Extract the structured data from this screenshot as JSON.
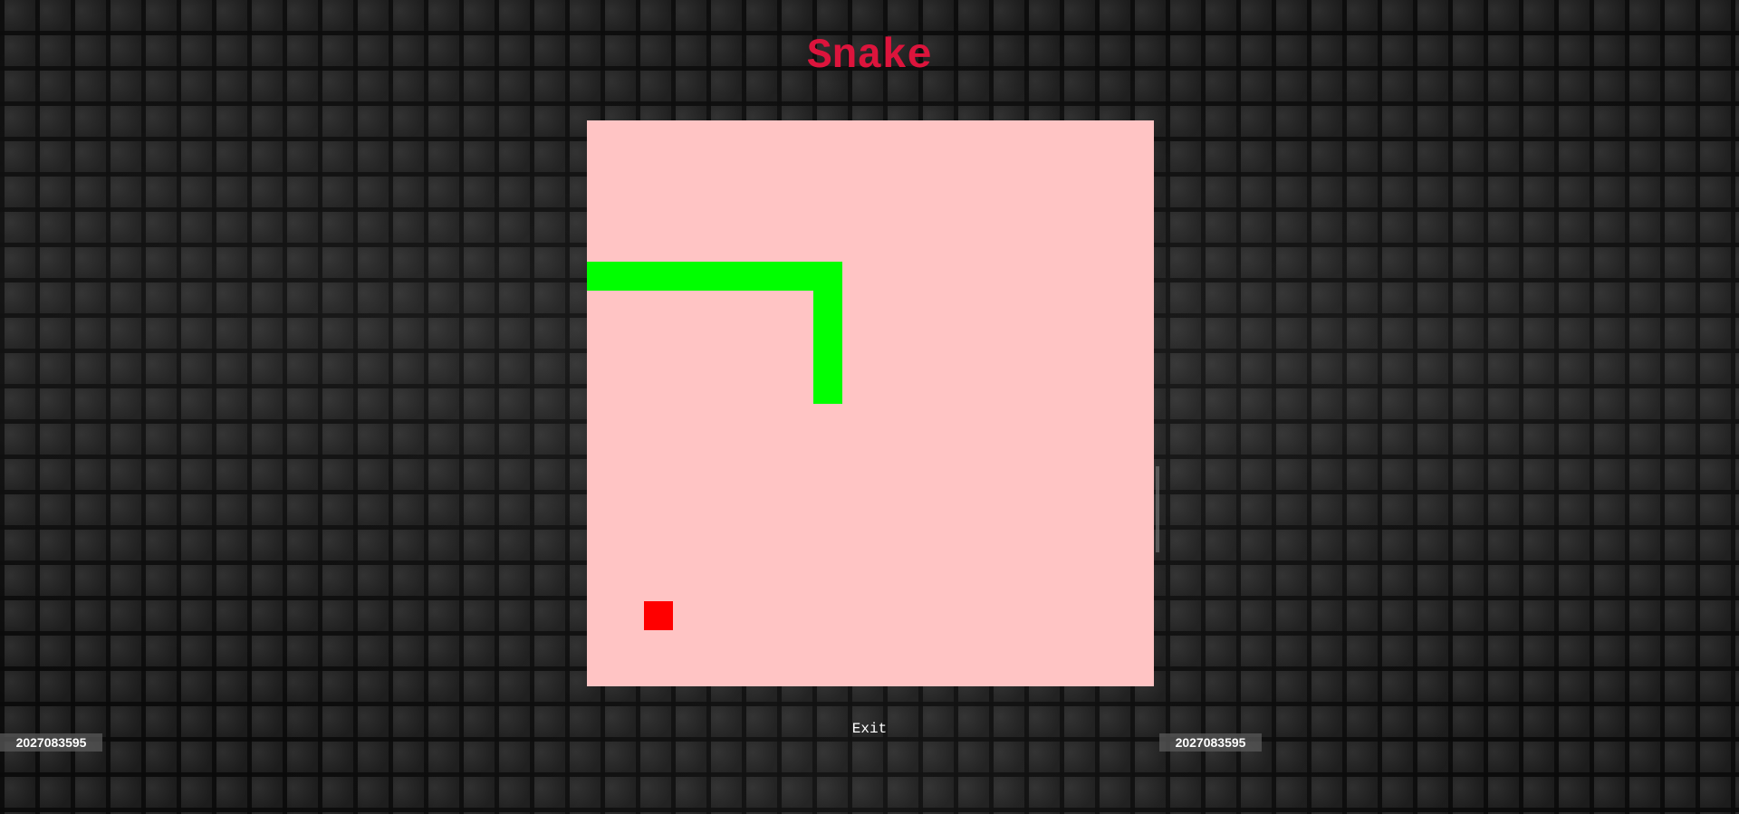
{
  "game": {
    "title": "Snake",
    "exit_label": "Exit",
    "grid_size": 20,
    "snake": [
      [
        0,
        5
      ],
      [
        1,
        5
      ],
      [
        2,
        5
      ],
      [
        3,
        5
      ],
      [
        4,
        5
      ],
      [
        5,
        5
      ],
      [
        6,
        5
      ],
      [
        7,
        5
      ],
      [
        8,
        5
      ],
      [
        8,
        6
      ],
      [
        8,
        7
      ],
      [
        8,
        8
      ],
      [
        8,
        9
      ]
    ],
    "food": [
      2,
      17
    ],
    "colors": {
      "title": "#dc143c",
      "board": "#ffc4c4",
      "snake": "#00ff00",
      "food": "#ff0000"
    }
  },
  "counters": {
    "left_value": "2027083595",
    "right_value": "2027083595"
  }
}
